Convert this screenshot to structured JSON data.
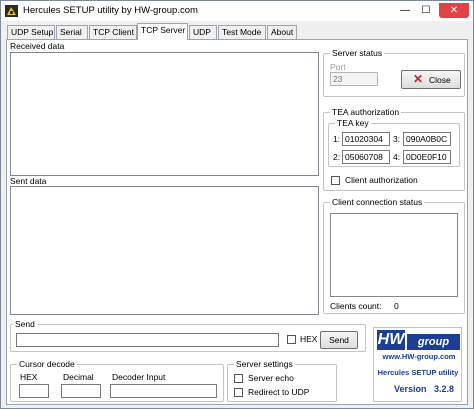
{
  "window": {
    "title": "Hercules SETUP utility by HW-group.com",
    "min": "—",
    "max": "☐",
    "close": "✕"
  },
  "tabs": [
    {
      "label": "UDP Setup"
    },
    {
      "label": "Serial"
    },
    {
      "label": "TCP Client"
    },
    {
      "label": "TCP Server"
    },
    {
      "label": "UDP"
    },
    {
      "label": "Test Mode"
    },
    {
      "label": "About"
    }
  ],
  "active_tab": "TCP Server",
  "received": {
    "label": "Received data"
  },
  "sent": {
    "label": "Sent data"
  },
  "server_status": {
    "label": "Server status",
    "port_label": "Port",
    "port_value": "23",
    "close_label": "Close"
  },
  "tea": {
    "label": "TEA authorization",
    "key_label": "TEA key",
    "keys": [
      {
        "n": "1:",
        "value": "01020304"
      },
      {
        "n": "2:",
        "value": "05060708"
      },
      {
        "n": "3:",
        "value": "090A0B0C"
      },
      {
        "n": "4:",
        "value": "0D0E0F10"
      }
    ],
    "client_auth_label": "Client authorization"
  },
  "client_connection": {
    "label": "Client connection status",
    "clients_label": "Clients count:",
    "clients_count": "0"
  },
  "send": {
    "label": "Send",
    "hex_label": "HEX",
    "button": "Send"
  },
  "cursor_decode": {
    "label": "Cursor decode",
    "hex_label": "HEX",
    "decimal_label": "Decimal",
    "decoder_label": "Decoder Input"
  },
  "server_settings": {
    "label": "Server settings",
    "echo_label": "Server echo",
    "redirect_label": "Redirect to UDP"
  },
  "logo": {
    "brand": "HW",
    "group": "group",
    "url": "www.HW-group.com",
    "product": "Hercules SETUP utility",
    "version_label": "Version",
    "version": "3.2.8"
  },
  "colors": {
    "logo_blue": "#1c3f94",
    "close_x": "#cc2222",
    "title_close": "#e04343"
  }
}
